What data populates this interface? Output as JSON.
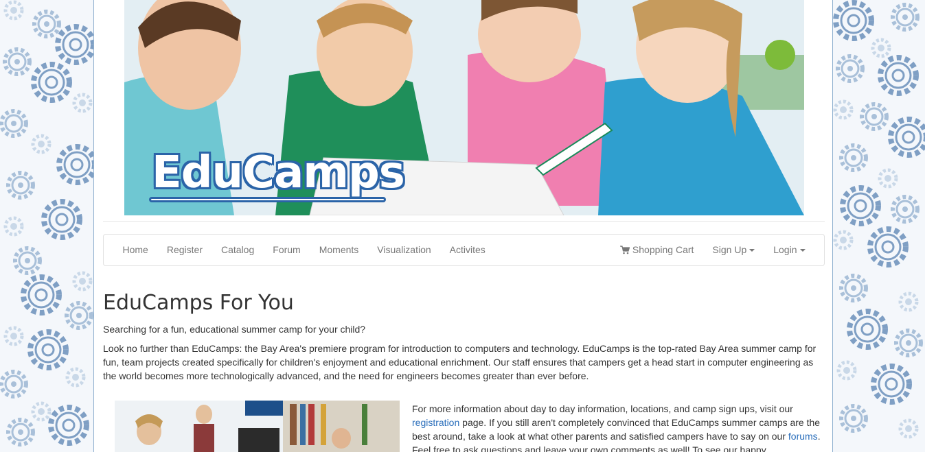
{
  "banner": {
    "logo_text": "EduCamps"
  },
  "navbar": {
    "left_items": [
      "Home",
      "Register",
      "Catalog",
      "Forum",
      "Moments",
      "Visualization",
      "Activites"
    ],
    "cart_label": "Shopping Cart",
    "signup_label": "Sign Up",
    "login_label": "Login"
  },
  "content": {
    "title": "EduCamps For You",
    "intro": "Searching for a fun, educational summer camp for your child?",
    "paragraph": "Look no further than EduCamps: the Bay Area's premiere program for introduction to computers and technology. EduCamps is the top-rated Bay Area summer camp for fun, team projects created specifically for children's enjoyment and educational enrichment. Our staff ensures that campers get a head start in computer engineering as the world becomes more technologically advanced, and the need for engineers becomes greater than ever before.",
    "info": {
      "text_1": "For more information about day to day information, locations, and camp sign ups, visit our ",
      "link_registration": "registration",
      "text_2": " page. If you still aren't completely convinced that EduCamps summer camps are the best around, take a look at what other parents and satisfied campers have to say on our ",
      "link_forums": "forums",
      "text_3": ". Feel free to ask questions and leave your own comments as well! To see our happy"
    }
  },
  "colors": {
    "link": "#2a6ebb",
    "nav_text": "#777777",
    "logo_outline": "#2b64a8",
    "gear_light": "#a9c0d9",
    "gear_dark": "#6b8cb3"
  }
}
